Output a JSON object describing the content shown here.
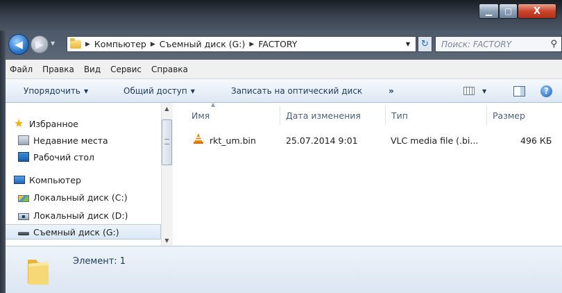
{
  "window": {
    "controls": {
      "minimize": "▁",
      "maximize": "▢",
      "close": "X"
    }
  },
  "address": {
    "breadcrumbs": [
      "Компьютер",
      "Съемный диск (G:)",
      "FACTORY"
    ],
    "search_placeholder": "Поиск: FACTORY"
  },
  "menu": [
    "Файл",
    "Правка",
    "Вид",
    "Сервис",
    "Справка"
  ],
  "toolbar": {
    "organize": "Упорядочить",
    "share": "Общий доступ",
    "burn": "Записать на оптический диск",
    "more": "»"
  },
  "nav": {
    "favorites": "Избранное",
    "recent": "Недавние места",
    "desktop": "Рабочий стол",
    "computer": "Компьютер",
    "disk_c": "Локальный диск (C:)",
    "disk_d": "Локальный диск (D:)",
    "disk_g": "Съемный диск (G:)"
  },
  "columns": {
    "name": "Имя",
    "date": "Дата изменения",
    "type": "Тип",
    "size": "Размер"
  },
  "files": [
    {
      "name": "rkt_um.bin",
      "date": "25.07.2014 9:01",
      "type": "VLC media file (.bi...",
      "size": "496 КБ"
    }
  ],
  "status": {
    "text": "Элемент: 1"
  }
}
